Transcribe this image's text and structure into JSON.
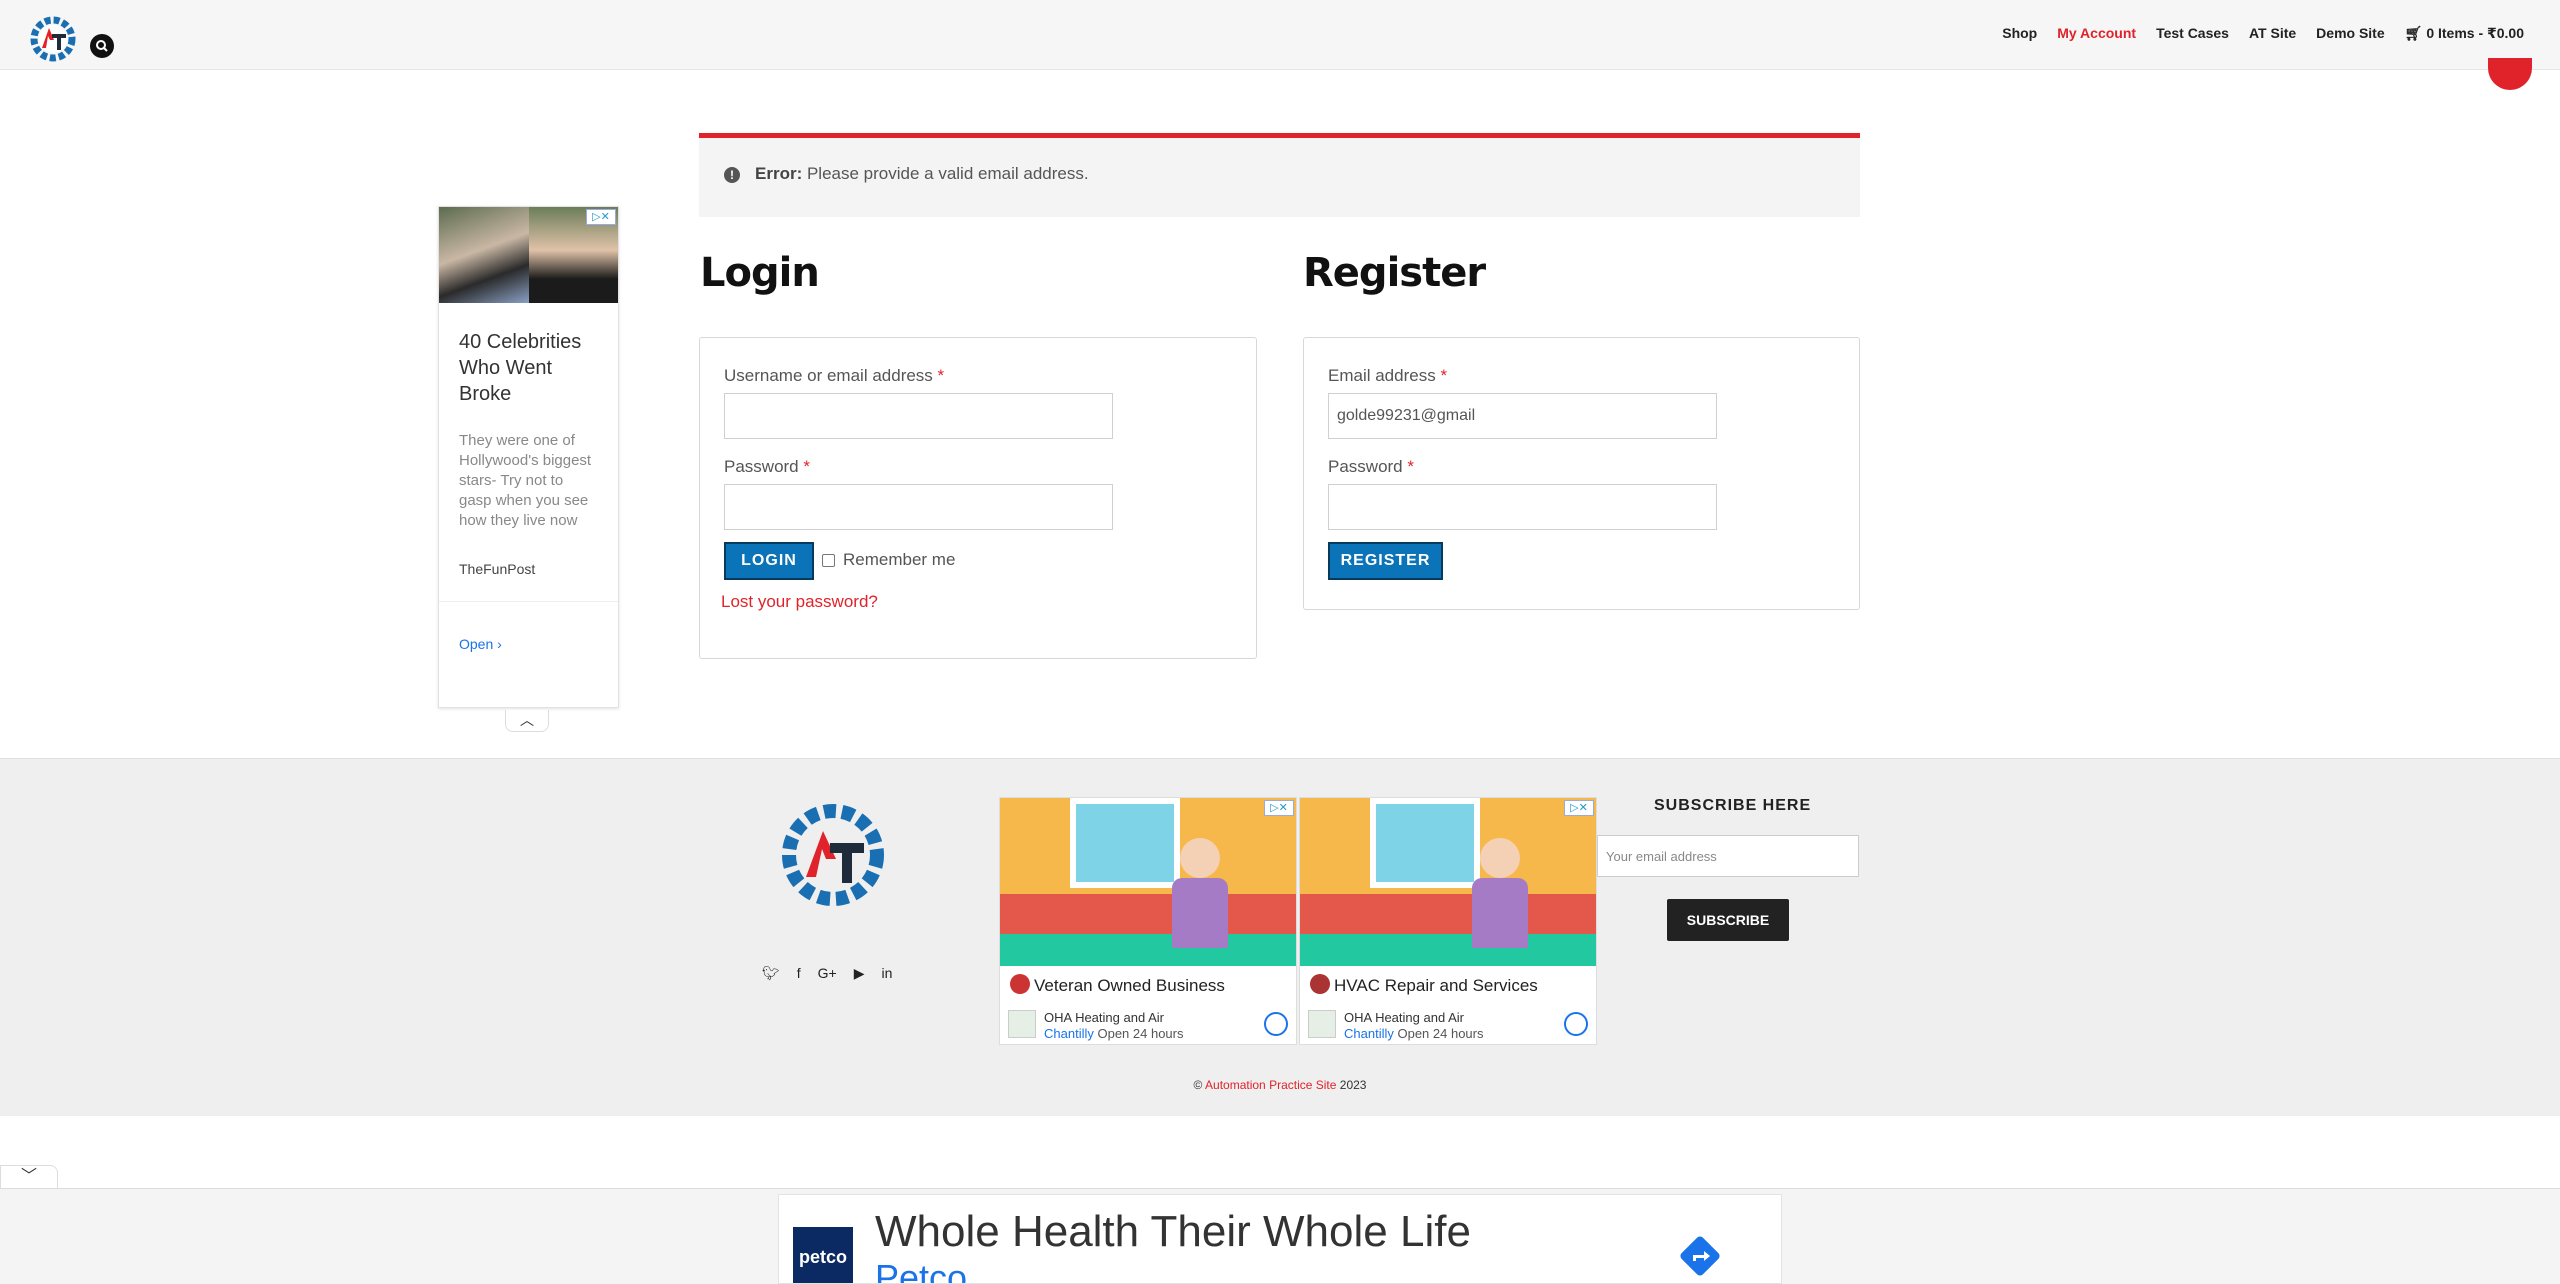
{
  "header": {
    "nav": [
      {
        "label": "Shop",
        "active": false
      },
      {
        "label": "My Account",
        "active": true
      },
      {
        "label": "Test Cases",
        "active": false
      },
      {
        "label": "AT Site",
        "active": false
      },
      {
        "label": "Demo Site",
        "active": false
      }
    ],
    "cart_label": "0 Items - ₹0.00",
    "icons": [
      "site-logo",
      "search-icon",
      "cart-icon"
    ]
  },
  "side_ad": {
    "title": "40 Celebrities Who Went Broke",
    "description": "They were one of Hollywood's biggest stars- Try not to gasp when you see how they live now",
    "source": "TheFunPost",
    "open_label": "Open",
    "adchoices": "▷✕"
  },
  "error": {
    "label": "Error:",
    "message": "Please provide a valid email address."
  },
  "login": {
    "title": "Login",
    "username_label": "Username or email address",
    "username_value": "",
    "password_label": "Password",
    "password_value": "",
    "required_mark": "*",
    "button": "LOGIN",
    "remember_label": "Remember me",
    "remember_checked": false,
    "lost_password": "Lost your password?"
  },
  "register": {
    "title": "Register",
    "email_label": "Email address",
    "email_value": "golde99231@gmail",
    "password_label": "Password",
    "password_value": "",
    "required_mark": "*",
    "button": "REGISTER"
  },
  "footer": {
    "social": [
      "twitter-icon",
      "facebook-icon",
      "google-plus-icon",
      "youtube-icon",
      "linkedin-icon"
    ],
    "ads": [
      {
        "headline": "Veteran Owned Business",
        "business": "OHA Heating and Air",
        "city": "Chantilly",
        "hours": "Open 24 hours"
      },
      {
        "headline": "HVAC Repair and Services",
        "business": "OHA Heating and Air",
        "city": "Chantilly",
        "hours": "Open 24 hours"
      }
    ],
    "subscribe_title": "SUBSCRIBE HERE",
    "subscribe_placeholder": "Your email address",
    "subscribe_button": "SUBSCRIBE",
    "copyright_symbol": "©",
    "copyright_link": "Automation Practice Site",
    "copyright_year": "2023"
  },
  "bottom_ad": {
    "brand": "petco",
    "headline": "Whole Health Their Whole Life",
    "subline": "Petco"
  },
  "colors": {
    "accent_red": "#e0232a",
    "button_blue": "#0b73b8",
    "link_blue": "#1a73e8"
  }
}
